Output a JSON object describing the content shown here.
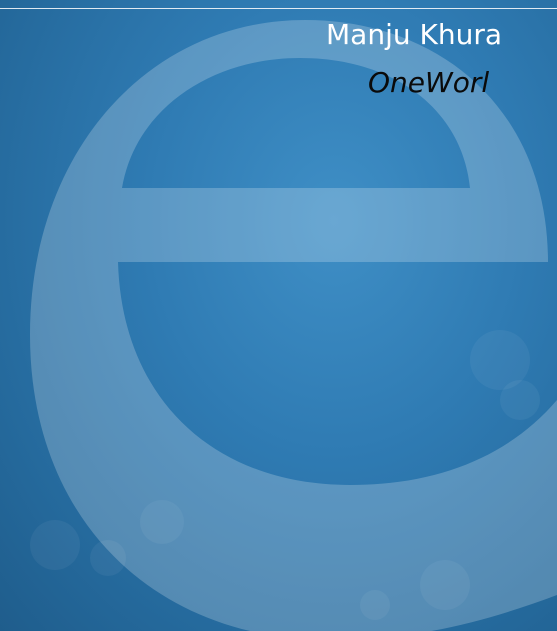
{
  "slide": {
    "author_name": "Manju Khura",
    "organization": "OneWorl",
    "background_logo_letter": "e"
  },
  "colors": {
    "background": "#2a6fa4",
    "author_text": "#ffffff",
    "organization_text": "#0a0a0a",
    "logo_tint": "rgba(255,255,255,0.22)"
  }
}
